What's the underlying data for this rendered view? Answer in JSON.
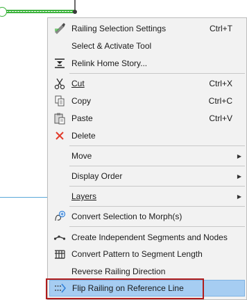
{
  "colors": {
    "menu_bg": "#f2f2f2",
    "highlight": "#a6cdf2",
    "focus_outline": "#b01c1c",
    "railing_green": "#3db33d",
    "delete_red": "#e23b2b"
  },
  "menu": {
    "items": [
      {
        "label": "Railing Selection Settings",
        "shortcut": "Ctrl+T",
        "icon": "railing-settings-icon"
      },
      {
        "label": "Select & Activate Tool",
        "shortcut": "",
        "icon": ""
      },
      {
        "label": "Relink Home Story...",
        "shortcut": "",
        "icon": "relink-story-icon"
      },
      {
        "label": "Cut",
        "shortcut": "Ctrl+X",
        "icon": "scissors-icon"
      },
      {
        "label": "Copy",
        "shortcut": "Ctrl+C",
        "icon": "copy-icon"
      },
      {
        "label": "Paste",
        "shortcut": "Ctrl+V",
        "icon": "paste-icon"
      },
      {
        "label": "Delete",
        "shortcut": "",
        "icon": "delete-x-icon"
      },
      {
        "label": "Move",
        "shortcut": "",
        "icon": ""
      },
      {
        "label": "Display Order",
        "shortcut": "",
        "icon": ""
      },
      {
        "label": "Layers",
        "shortcut": "",
        "icon": ""
      },
      {
        "label": "Convert Selection to Morph(s)",
        "shortcut": "",
        "icon": "morph-icon"
      },
      {
        "label": "Create Independent Segments and Nodes",
        "shortcut": "",
        "icon": "segments-nodes-icon"
      },
      {
        "label": "Convert Pattern to Segment Length",
        "shortcut": "",
        "icon": "pattern-segment-icon"
      },
      {
        "label": "Reverse Railing Direction",
        "shortcut": "",
        "icon": ""
      },
      {
        "label": "Flip Railing on Reference Line",
        "shortcut": "",
        "icon": "flip-railing-icon"
      }
    ]
  }
}
